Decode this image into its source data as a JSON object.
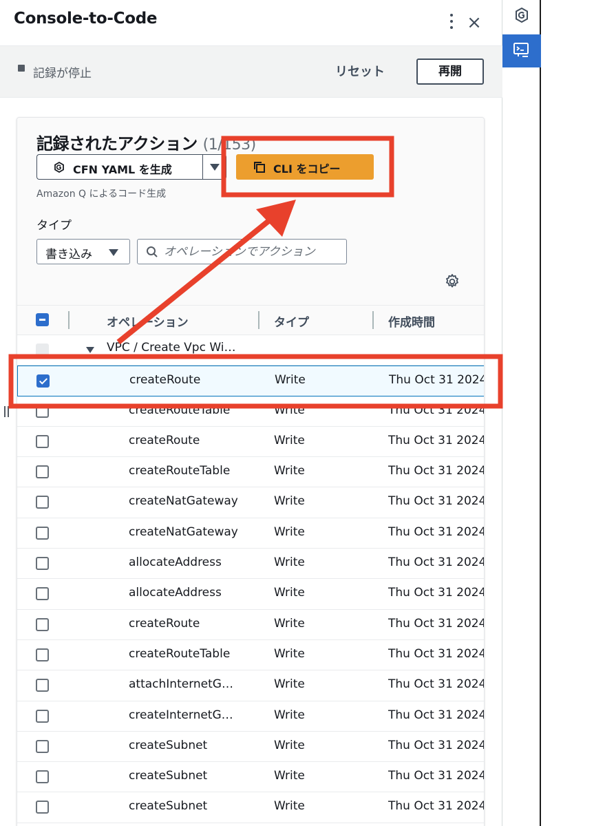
{
  "header": {
    "title": "Console-to-Code",
    "close_glyph": "×"
  },
  "status": {
    "text": "記録が停止",
    "reset_label": "リセット",
    "resume_label": "再開"
  },
  "actions": {
    "title": "記録されたアクション",
    "count": "(1/153)",
    "cfn_button_label": "CFN YAML を生成",
    "cli_button_label": "CLI をコピー",
    "caption": "Amazon Q によるコード生成",
    "type_label": "タイプ",
    "type_value": "書き込み",
    "search_placeholder": "オペレーションでアクション"
  },
  "table": {
    "columns": [
      "オペレーション",
      "タイプ",
      "作成時間"
    ],
    "group_name": "VPC / Create Vpc Wi…",
    "rows": [
      {
        "operation": "createRoute",
        "type": "Write",
        "time": "Thu Oct 31 2024",
        "checked": true
      },
      {
        "operation": "createRouteTable",
        "type": "Write",
        "time": "Thu Oct 31 2024",
        "checked": false
      },
      {
        "operation": "createRoute",
        "type": "Write",
        "time": "Thu Oct 31 2024",
        "checked": false
      },
      {
        "operation": "createRouteTable",
        "type": "Write",
        "time": "Thu Oct 31 2024",
        "checked": false
      },
      {
        "operation": "createNatGateway",
        "type": "Write",
        "time": "Thu Oct 31 2024",
        "checked": false
      },
      {
        "operation": "createNatGateway",
        "type": "Write",
        "time": "Thu Oct 31 2024",
        "checked": false
      },
      {
        "operation": "allocateAddress",
        "type": "Write",
        "time": "Thu Oct 31 2024",
        "checked": false
      },
      {
        "operation": "allocateAddress",
        "type": "Write",
        "time": "Thu Oct 31 2024",
        "checked": false
      },
      {
        "operation": "createRoute",
        "type": "Write",
        "time": "Thu Oct 31 2024",
        "checked": false
      },
      {
        "operation": "createRouteTable",
        "type": "Write",
        "time": "Thu Oct 31 2024",
        "checked": false
      },
      {
        "operation": "attachInternetG…",
        "type": "Write",
        "time": "Thu Oct 31 2024",
        "checked": false
      },
      {
        "operation": "createInternetG…",
        "type": "Write",
        "time": "Thu Oct 31 2024",
        "checked": false
      },
      {
        "operation": "createSubnet",
        "type": "Write",
        "time": "Thu Oct 31 2024",
        "checked": false
      },
      {
        "operation": "createSubnet",
        "type": "Write",
        "time": "Thu Oct 31 2024",
        "checked": false
      },
      {
        "operation": "createSubnet",
        "type": "Write",
        "time": "Thu Oct 31 2024",
        "checked": false
      }
    ]
  },
  "colors": {
    "primary_button": "#ec9e2e",
    "selection_blue": "#2d6ecc",
    "annotation_red": "#e8412c"
  },
  "icons": {
    "strip_top": "cloudformation-icon",
    "strip_active": "console-to-code-icon"
  }
}
